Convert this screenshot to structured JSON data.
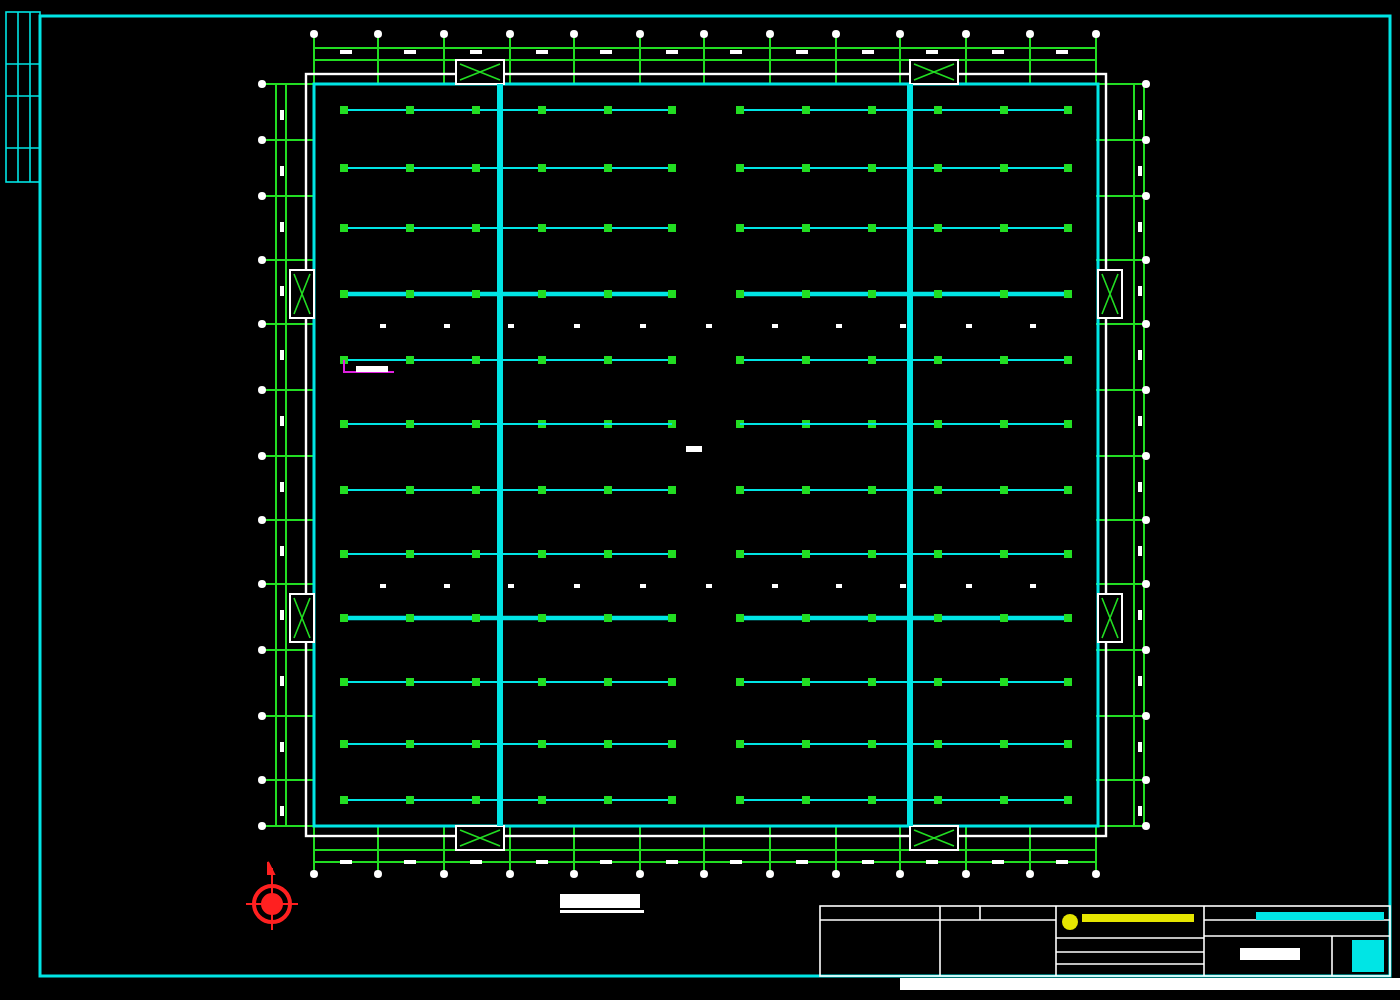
{
  "plan": {
    "light_rows": [
      {
        "kind": "thin"
      },
      {
        "kind": "thin"
      },
      {
        "kind": "thin"
      },
      {
        "kind": "thick"
      },
      {
        "kind": "thin"
      },
      {
        "kind": "thin"
      },
      {
        "kind": "thin"
      },
      {
        "kind": "thin"
      },
      {
        "kind": "thick"
      },
      {
        "kind": "thin"
      },
      {
        "kind": "thin"
      },
      {
        "kind": "thin"
      }
    ]
  }
}
